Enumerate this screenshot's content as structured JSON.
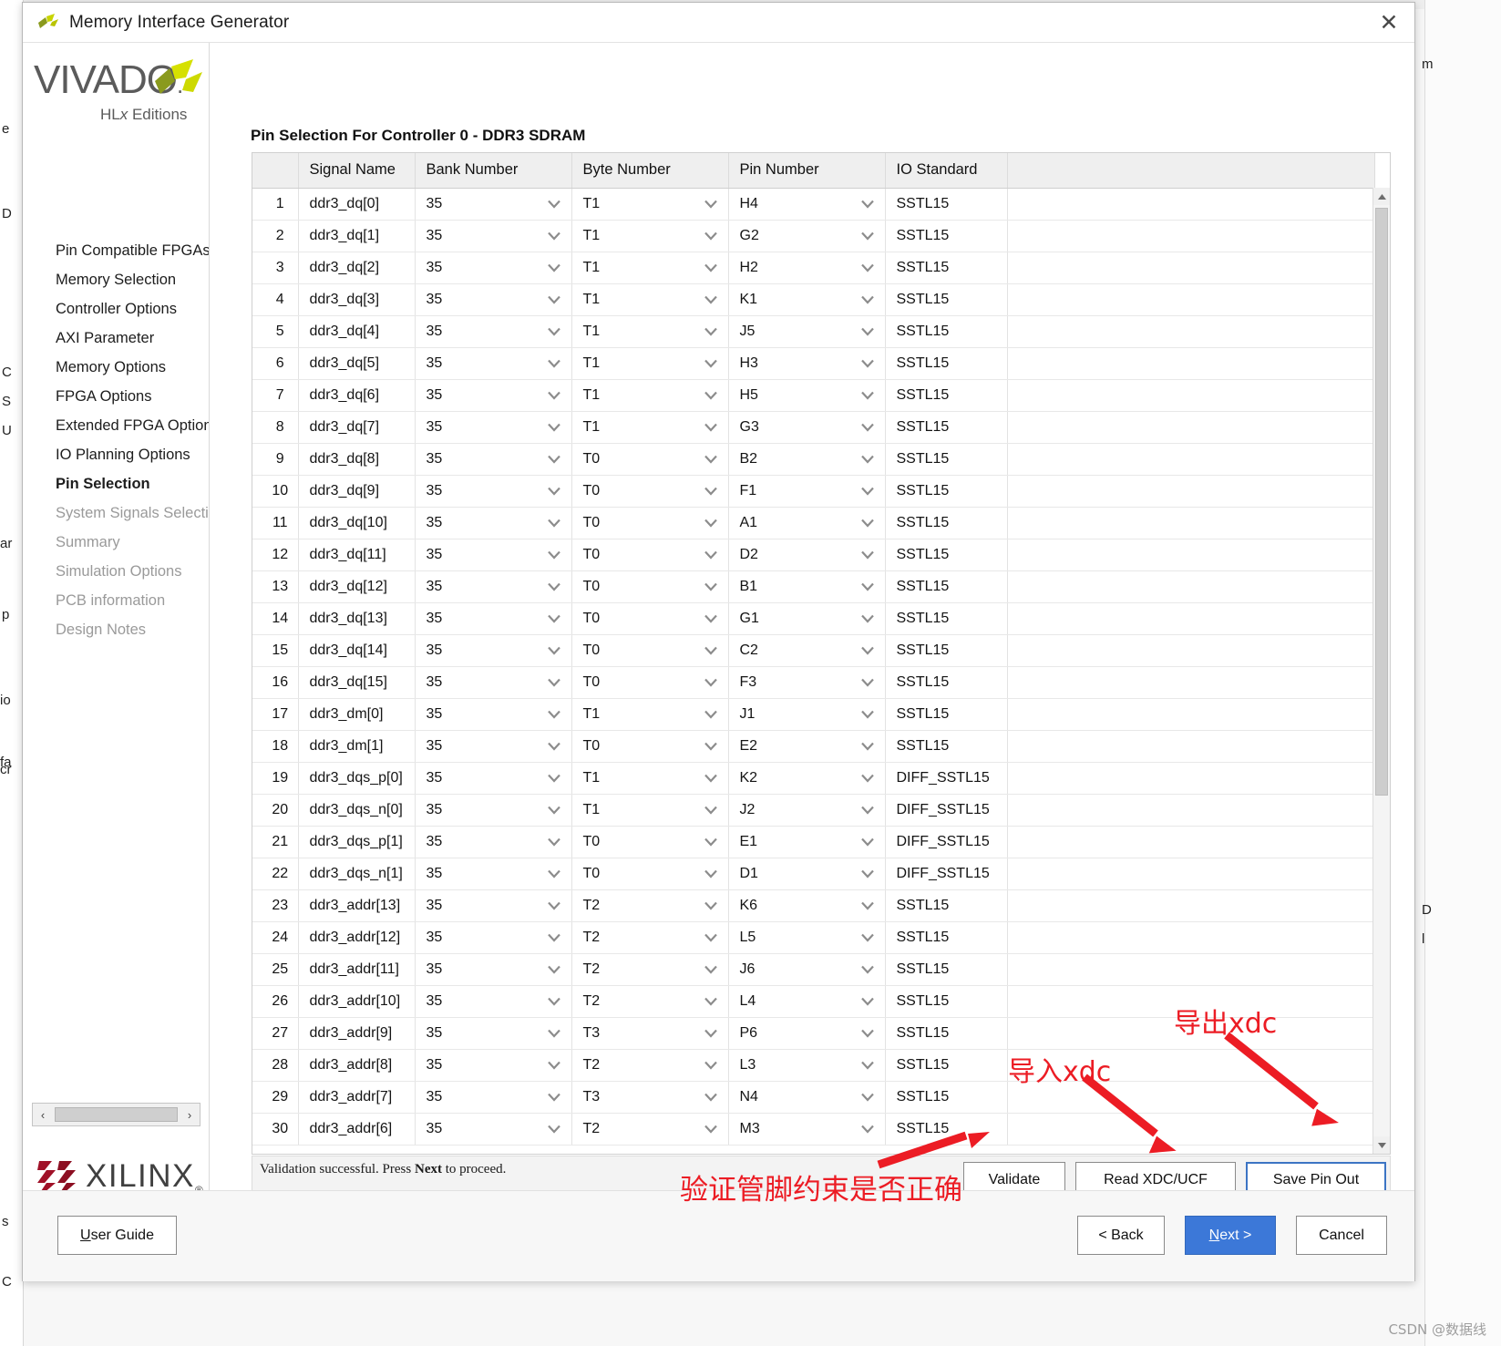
{
  "window": {
    "title": "Memory Interface Generator",
    "close_label": "✕"
  },
  "branding": {
    "vivado": "VIVADO",
    "vivado_dot": ".",
    "hlx_prefix": "HL",
    "hlx_italic": "x",
    "hlx_suffix": " Editions",
    "xilinx": "XILINX",
    "xilinx_reg": "®"
  },
  "sidebar": {
    "items": [
      {
        "label": "Pin Compatible FPGAs",
        "state": "normal"
      },
      {
        "label": "Memory Selection",
        "state": "normal"
      },
      {
        "label": "Controller Options",
        "state": "normal"
      },
      {
        "label": "AXI Parameter",
        "state": "normal"
      },
      {
        "label": "Memory Options",
        "state": "normal"
      },
      {
        "label": "FPGA Options",
        "state": "normal"
      },
      {
        "label": "Extended FPGA Options",
        "state": "normal"
      },
      {
        "label": "IO Planning Options",
        "state": "normal"
      },
      {
        "label": "Pin Selection",
        "state": "current"
      },
      {
        "label": "System Signals Selection",
        "state": "disabled"
      },
      {
        "label": "Summary",
        "state": "disabled"
      },
      {
        "label": "Simulation Options",
        "state": "disabled"
      },
      {
        "label": "PCB information",
        "state": "disabled"
      },
      {
        "label": "Design Notes",
        "state": "disabled"
      }
    ],
    "scroll_left": "‹",
    "scroll_right": "›"
  },
  "main": {
    "panel_title": "Pin Selection For Controller 0 - DDR3 SDRAM",
    "columns": [
      "",
      "Signal Name",
      "Bank Number",
      "Byte Number",
      "Pin Number",
      "IO Standard",
      ""
    ],
    "rows": [
      {
        "idx": "1",
        "signal": "ddr3_dq[0]",
        "bank": "35",
        "byte": "T1",
        "pin": "H4",
        "io": "SSTL15"
      },
      {
        "idx": "2",
        "signal": "ddr3_dq[1]",
        "bank": "35",
        "byte": "T1",
        "pin": "G2",
        "io": "SSTL15"
      },
      {
        "idx": "3",
        "signal": "ddr3_dq[2]",
        "bank": "35",
        "byte": "T1",
        "pin": "H2",
        "io": "SSTL15"
      },
      {
        "idx": "4",
        "signal": "ddr3_dq[3]",
        "bank": "35",
        "byte": "T1",
        "pin": "K1",
        "io": "SSTL15"
      },
      {
        "idx": "5",
        "signal": "ddr3_dq[4]",
        "bank": "35",
        "byte": "T1",
        "pin": "J5",
        "io": "SSTL15"
      },
      {
        "idx": "6",
        "signal": "ddr3_dq[5]",
        "bank": "35",
        "byte": "T1",
        "pin": "H3",
        "io": "SSTL15"
      },
      {
        "idx": "7",
        "signal": "ddr3_dq[6]",
        "bank": "35",
        "byte": "T1",
        "pin": "H5",
        "io": "SSTL15"
      },
      {
        "idx": "8",
        "signal": "ddr3_dq[7]",
        "bank": "35",
        "byte": "T1",
        "pin": "G3",
        "io": "SSTL15"
      },
      {
        "idx": "9",
        "signal": "ddr3_dq[8]",
        "bank": "35",
        "byte": "T0",
        "pin": "B2",
        "io": "SSTL15"
      },
      {
        "idx": "10",
        "signal": "ddr3_dq[9]",
        "bank": "35",
        "byte": "T0",
        "pin": "F1",
        "io": "SSTL15"
      },
      {
        "idx": "11",
        "signal": "ddr3_dq[10]",
        "bank": "35",
        "byte": "T0",
        "pin": "A1",
        "io": "SSTL15"
      },
      {
        "idx": "12",
        "signal": "ddr3_dq[11]",
        "bank": "35",
        "byte": "T0",
        "pin": "D2",
        "io": "SSTL15"
      },
      {
        "idx": "13",
        "signal": "ddr3_dq[12]",
        "bank": "35",
        "byte": "T0",
        "pin": "B1",
        "io": "SSTL15"
      },
      {
        "idx": "14",
        "signal": "ddr3_dq[13]",
        "bank": "35",
        "byte": "T0",
        "pin": "G1",
        "io": "SSTL15"
      },
      {
        "idx": "15",
        "signal": "ddr3_dq[14]",
        "bank": "35",
        "byte": "T0",
        "pin": "C2",
        "io": "SSTL15"
      },
      {
        "idx": "16",
        "signal": "ddr3_dq[15]",
        "bank": "35",
        "byte": "T0",
        "pin": "F3",
        "io": "SSTL15"
      },
      {
        "idx": "17",
        "signal": "ddr3_dm[0]",
        "bank": "35",
        "byte": "T1",
        "pin": "J1",
        "io": "SSTL15"
      },
      {
        "idx": "18",
        "signal": "ddr3_dm[1]",
        "bank": "35",
        "byte": "T0",
        "pin": "E2",
        "io": "SSTL15"
      },
      {
        "idx": "19",
        "signal": "ddr3_dqs_p[0]",
        "bank": "35",
        "byte": "T1",
        "pin": "K2",
        "io": "DIFF_SSTL15"
      },
      {
        "idx": "20",
        "signal": "ddr3_dqs_n[0]",
        "bank": "35",
        "byte": "T1",
        "pin": "J2",
        "io": "DIFF_SSTL15"
      },
      {
        "idx": "21",
        "signal": "ddr3_dqs_p[1]",
        "bank": "35",
        "byte": "T0",
        "pin": "E1",
        "io": "DIFF_SSTL15"
      },
      {
        "idx": "22",
        "signal": "ddr3_dqs_n[1]",
        "bank": "35",
        "byte": "T0",
        "pin": "D1",
        "io": "DIFF_SSTL15"
      },
      {
        "idx": "23",
        "signal": "ddr3_addr[13]",
        "bank": "35",
        "byte": "T2",
        "pin": "K6",
        "io": "SSTL15"
      },
      {
        "idx": "24",
        "signal": "ddr3_addr[12]",
        "bank": "35",
        "byte": "T2",
        "pin": "L5",
        "io": "SSTL15"
      },
      {
        "idx": "25",
        "signal": "ddr3_addr[11]",
        "bank": "35",
        "byte": "T2",
        "pin": "J6",
        "io": "SSTL15"
      },
      {
        "idx": "26",
        "signal": "ddr3_addr[10]",
        "bank": "35",
        "byte": "T2",
        "pin": "L4",
        "io": "SSTL15"
      },
      {
        "idx": "27",
        "signal": "ddr3_addr[9]",
        "bank": "35",
        "byte": "T3",
        "pin": "P6",
        "io": "SSTL15"
      },
      {
        "idx": "28",
        "signal": "ddr3_addr[8]",
        "bank": "35",
        "byte": "T2",
        "pin": "L3",
        "io": "SSTL15"
      },
      {
        "idx": "29",
        "signal": "ddr3_addr[7]",
        "bank": "35",
        "byte": "T3",
        "pin": "N4",
        "io": "SSTL15"
      },
      {
        "idx": "30",
        "signal": "ddr3_addr[6]",
        "bank": "35",
        "byte": "T2",
        "pin": "M3",
        "io": "SSTL15"
      }
    ],
    "status_prefix": "Validation successful. Press ",
    "status_bold": "Next",
    "status_suffix": " to proceed.",
    "actions": {
      "validate": "Validate",
      "read_xdc": "Read XDC/UCF",
      "save_pin_out": "Save Pin Out"
    }
  },
  "footer": {
    "user_guide_u": "U",
    "user_guide_rest": "ser Guide",
    "back": "< Back",
    "next_n": "N",
    "next_rest": "ext >",
    "cancel": "Cancel"
  },
  "annotations": {
    "export_xdc": "导出xdc",
    "import_xdc": "导入xdc",
    "validate_note": "验证管脚约束是否正确",
    "watermark": "CSDN @数据线"
  },
  "background_text": {
    "fragments": [
      "e",
      "D",
      "C",
      "S",
      "U",
      "p",
      "ar",
      "io",
      "fa",
      "cr",
      "s",
      "C",
      "m",
      "D",
      "l"
    ]
  },
  "colors": {
    "accent_blue": "#3c78d8",
    "annotation_red": "#ec1c24",
    "header_grey": "#efefef",
    "vivado_green": "#c8d400"
  }
}
